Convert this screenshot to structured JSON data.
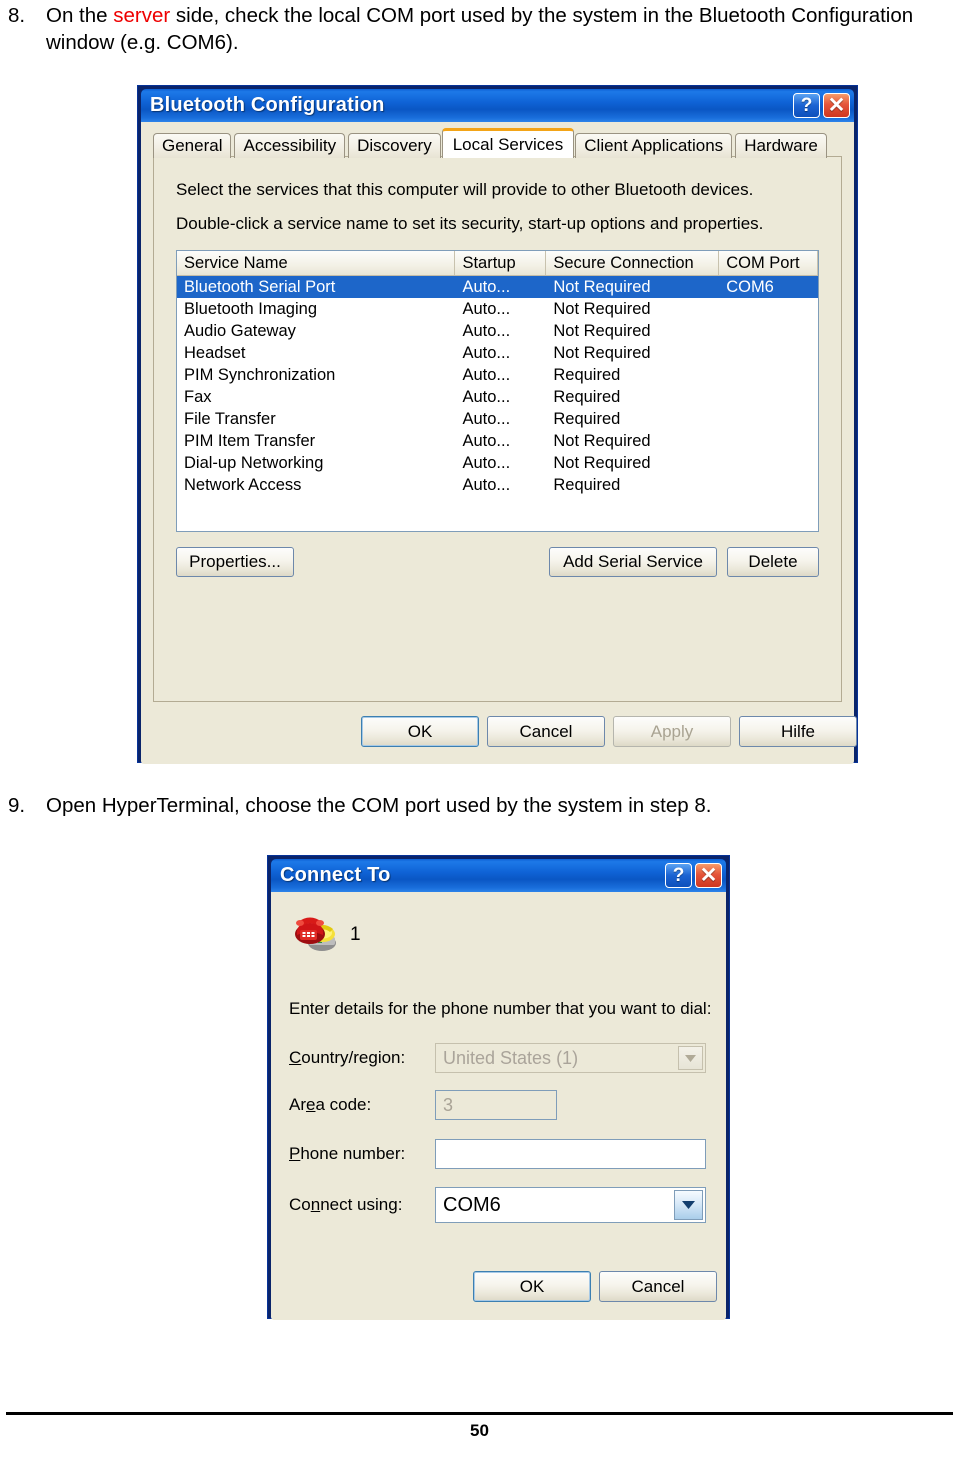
{
  "document": {
    "page_number": "50",
    "steps": [
      {
        "number": "8.",
        "text_before": "On the ",
        "highlight": "server",
        "text_after": " side, check the local COM port used by the system in the Bluetooth Configuration window (e.g. COM6).",
        "highlight_color": "#ee0000"
      },
      {
        "number": "9.",
        "text": "Open HyperTerminal, choose the COM port used by the system in step 8."
      }
    ]
  },
  "bluetooth_dialog": {
    "title": "Bluetooth Configuration",
    "help_button": "?",
    "close_button": "✕",
    "tabs": [
      {
        "label": "General",
        "active": false
      },
      {
        "label": "Accessibility",
        "active": false
      },
      {
        "label": "Discovery",
        "active": false
      },
      {
        "label": "Local Services",
        "active": true
      },
      {
        "label": "Client Applications",
        "active": false
      },
      {
        "label": "Hardware",
        "active": false
      }
    ],
    "active_tab_accent": "#f3a417",
    "pane_text_line1": "Select the services that this computer will provide to other Bluetooth devices.",
    "pane_text_line2": "Double-click a service name to set its security, start-up options and properties.",
    "list": {
      "columns": [
        "Service Name",
        "Startup",
        "Secure Connection",
        "COM Port"
      ],
      "selection_color": "#1d66c9",
      "rows": [
        {
          "name": "Bluetooth Serial Port",
          "startup": "Auto...",
          "secure": "Not Required",
          "com": "COM6",
          "selected": true
        },
        {
          "name": "Bluetooth Imaging",
          "startup": "Auto...",
          "secure": "Not Required",
          "com": "",
          "selected": false
        },
        {
          "name": "Audio Gateway",
          "startup": "Auto...",
          "secure": "Not Required",
          "com": "",
          "selected": false
        },
        {
          "name": "Headset",
          "startup": "Auto...",
          "secure": "Not Required",
          "com": "",
          "selected": false
        },
        {
          "name": "PIM Synchronization",
          "startup": "Auto...",
          "secure": "Required",
          "com": "",
          "selected": false
        },
        {
          "name": "Fax",
          "startup": "Auto...",
          "secure": "Required",
          "com": "",
          "selected": false
        },
        {
          "name": "File Transfer",
          "startup": "Auto...",
          "secure": "Required",
          "com": "",
          "selected": false
        },
        {
          "name": "PIM Item Transfer",
          "startup": "Auto...",
          "secure": "Not Required",
          "com": "",
          "selected": false
        },
        {
          "name": "Dial-up Networking",
          "startup": "Auto...",
          "secure": "Not Required",
          "com": "",
          "selected": false
        },
        {
          "name": "Network Access",
          "startup": "Auto...",
          "secure": "Required",
          "com": "",
          "selected": false
        }
      ]
    },
    "buttons": {
      "properties": "Properties...",
      "add_serial_service": "Add Serial Service",
      "delete": "Delete",
      "ok": "OK",
      "cancel": "Cancel",
      "apply": "Apply",
      "apply_disabled": true,
      "hilfe": "Hilfe"
    }
  },
  "connect_to_dialog": {
    "title": "Connect To",
    "help_button": "?",
    "close_button": "✕",
    "connection_name": "1",
    "icon": "phone-icon",
    "prompt": "Enter details for the phone number that you want to dial:",
    "fields": [
      {
        "label": "Country/region:",
        "value": "United States (1)",
        "type": "combobox",
        "disabled": true
      },
      {
        "label": "Area code:",
        "value": "3",
        "type": "textbox",
        "disabled": true
      },
      {
        "label": "Phone number:",
        "value": "",
        "type": "textbox",
        "disabled": false
      },
      {
        "label": "Connect using:",
        "value": "COM6",
        "type": "combobox",
        "disabled": false
      }
    ],
    "buttons": {
      "ok": "OK",
      "cancel": "Cancel"
    }
  }
}
